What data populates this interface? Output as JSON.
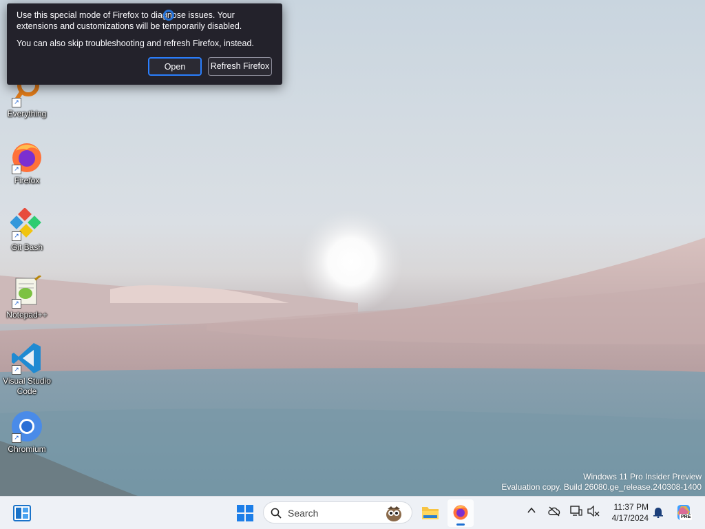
{
  "desktop": {
    "icons": [
      {
        "label": "Everything",
        "icon": "everything-icon"
      },
      {
        "label": "Firefox",
        "icon": "firefox-icon"
      },
      {
        "label": "Git Bash",
        "icon": "git-bash-icon"
      },
      {
        "label": "Notepad++",
        "icon": "notepad-plus-plus-icon"
      },
      {
        "label": "Visual Studio Code",
        "icon": "vscode-icon"
      },
      {
        "label": "Chromium",
        "icon": "chromium-icon"
      }
    ],
    "watermark": {
      "line1": "Windows 11 Pro Insider Preview",
      "line2": "Evaluation copy. Build 26080.ge_release.240308-1400"
    }
  },
  "popup": {
    "message1": "Use this special mode of Firefox to diagnose issues. Your extensions and customizations will be temporarily disabled.",
    "message2": "You can also skip troubleshooting and refresh Firefox, instead.",
    "open_label": "Open",
    "refresh_label": "Refresh Firefox"
  },
  "taskbar": {
    "search_placeholder": "Search",
    "time": "11:37 PM",
    "date": "4/17/2024",
    "copilot_badge": "PRE"
  },
  "colors": {
    "popup_bg": "#23222b",
    "focus_ring": "#2a7fff",
    "taskbar_bg": "#eef1f6"
  }
}
